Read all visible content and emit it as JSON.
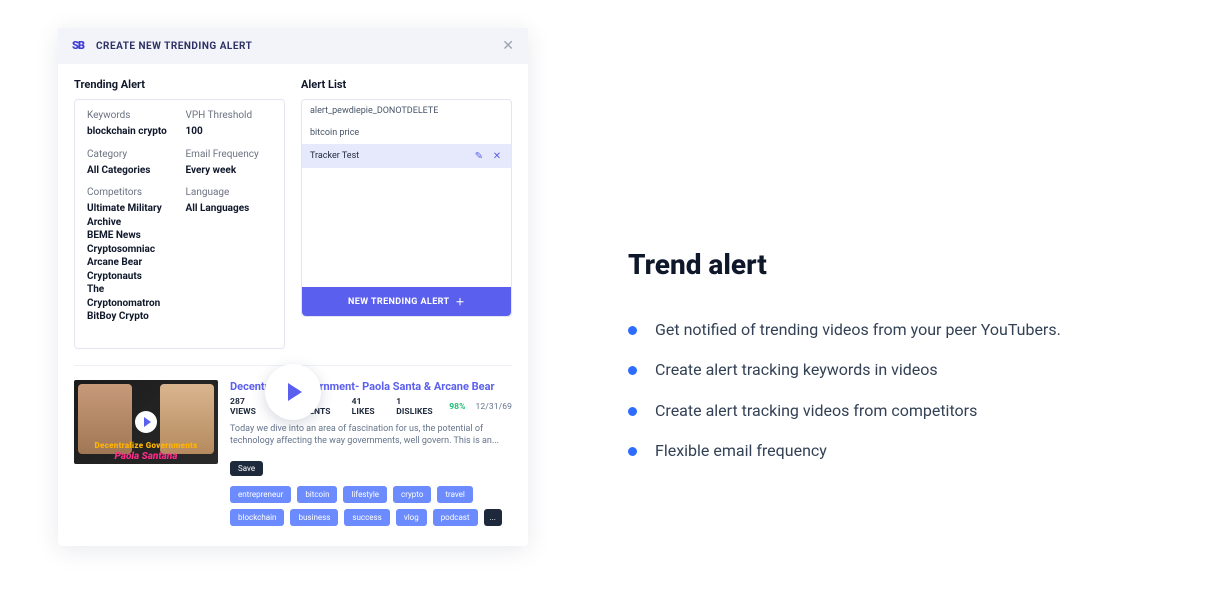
{
  "dialog": {
    "title": "CREATE NEW TRENDING ALERT",
    "sections": {
      "left_heading": "Trending Alert",
      "right_heading": "Alert List"
    },
    "fields": {
      "keywords": {
        "label": "Keywords",
        "value": "blockchain  crypto"
      },
      "vph": {
        "label": "VPH Threshold",
        "value": "100"
      },
      "category": {
        "label": "Category",
        "value": "All Categories"
      },
      "email_freq": {
        "label": "Email Frequency",
        "value": "Every week"
      },
      "competitors": {
        "label": "Competitors",
        "value": "Ultimate Military Archive\nBEME News\nCryptosomniac\nArcane Bear\nCryptonauts\nThe Cryptonomatron\nBitBoy Crypto"
      },
      "language": {
        "label": "Language",
        "value": "All Languages"
      }
    },
    "alert_list": {
      "items": [
        {
          "name": "alert_pewdiepie_DONOTDELETE",
          "selected": false
        },
        {
          "name": "bitcoin price",
          "selected": false
        },
        {
          "name": "Tracker Test",
          "selected": true
        }
      ],
      "new_button": "NEW TRENDING ALERT"
    }
  },
  "video": {
    "title": "Decentralize Government- Paola Santa & Arcane Bear",
    "views": "287 VIEWS",
    "comments": "15 COMMENTS",
    "likes": "41 LIKES",
    "dislikes": "1 DISLIKES",
    "pct": "98%",
    "date": "12/31/69",
    "desc": "Today we dive into an area of fascination for us, the potential of technology affecting the way governments, well govern. This is an...",
    "save": "Save",
    "thumb_band": "Decentralize Governments",
    "thumb_name": "Paola Santana",
    "tags": [
      "entrepreneur",
      "bitcoin",
      "lifestyle",
      "crypto",
      "travel",
      "blockchain",
      "business",
      "success",
      "vlog",
      "podcast"
    ],
    "more": "..."
  },
  "marketing": {
    "heading": "Trend alert",
    "bullets": [
      "Get notified of trending videos from your peer YouTubers.",
      "Create alert tracking keywords in videos",
      "Create alert tracking videos from competitors",
      "Flexible email frequency"
    ]
  }
}
